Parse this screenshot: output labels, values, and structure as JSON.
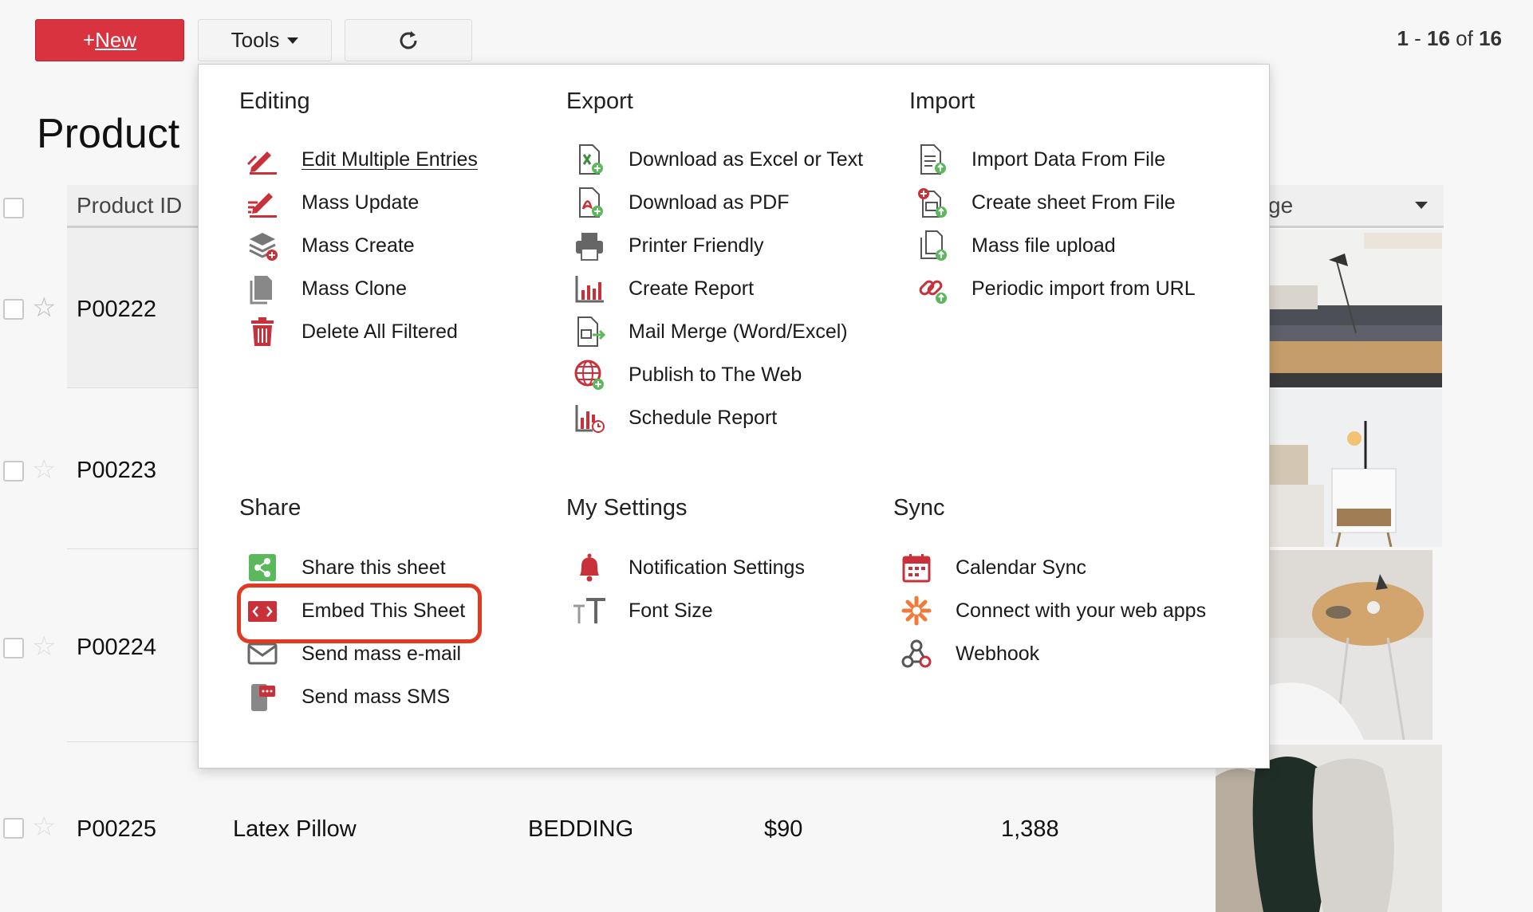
{
  "toolbar": {
    "new_prefix": "+",
    "new_label": "New",
    "tools_label": "Tools",
    "refresh_icon": "refresh-icon"
  },
  "pager": {
    "start": "1",
    "sep": " - ",
    "end": "16",
    "of": " of ",
    "total": "16"
  },
  "page_title": "Product",
  "table": {
    "col_product_id": "Product ID",
    "col_image_partial": "ge",
    "rows": [
      {
        "id": "P00222"
      },
      {
        "id": "P00223"
      },
      {
        "id": "P00224"
      },
      {
        "id": "P00225",
        "name": "Latex Pillow",
        "category": "BEDDING",
        "price": "$90",
        "qty": "1,388"
      }
    ]
  },
  "menu": {
    "editing": {
      "title": "Editing",
      "items": [
        "Edit Multiple Entries",
        "Mass Update",
        "Mass Create",
        "Mass Clone",
        "Delete All Filtered"
      ]
    },
    "export": {
      "title": "Export",
      "items": [
        "Download as Excel or Text",
        "Download as PDF",
        "Printer Friendly",
        "Create Report",
        "Mail Merge (Word/Excel)",
        "Publish to The Web",
        "Schedule Report"
      ]
    },
    "import": {
      "title": "Import",
      "items": [
        "Import Data From File",
        "Create sheet From File",
        "Mass file upload",
        "Periodic import from URL"
      ]
    },
    "share": {
      "title": "Share",
      "items": [
        "Share this sheet",
        "Embed This Sheet",
        "Send mass e-mail",
        "Send mass SMS"
      ]
    },
    "settings": {
      "title": "My Settings",
      "items": [
        "Notification Settings",
        "Font Size"
      ]
    },
    "sync": {
      "title": "Sync",
      "items": [
        "Calendar Sync",
        "Connect with your web apps",
        "Webhook"
      ]
    }
  },
  "colors": {
    "brand_red": "#d9333f",
    "icon_red": "#c8303a",
    "icon_green": "#5cb85c",
    "highlight": "#e23a22"
  }
}
